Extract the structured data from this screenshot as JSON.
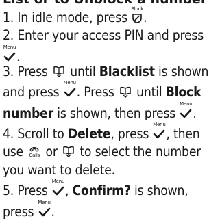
{
  "heading": "List or to Unblock a number",
  "icons": {
    "end_key": "end-call-icon",
    "menu_key": "menu-tick-icon",
    "navigation_key": "phonebook-nav-icon",
    "calls_key": "calls-icon"
  },
  "labels": {
    "block": "Block",
    "menu": "Menu",
    "calls": "Calls"
  },
  "steps": [
    {
      "num": "1.",
      "a": " In idle mode, press ",
      "b": "."
    },
    {
      "num": "2.",
      "a": " Enter your access PIN and press"
    },
    {
      "num": "3.",
      "a": " Press ",
      "b": " until ",
      "c": "Blacklist",
      "d": " is shown",
      "e": "and press ",
      "f": ". Press ",
      "g": " until ",
      "h": "Block",
      "i": "number",
      "j": " is shown, then press ",
      "k": "."
    },
    {
      "num": "4.",
      "a": " Scroll to ",
      "b": "Delete",
      "c": ", press ",
      "d": ", then",
      "e": "use ",
      "f": " or ",
      "g": " to select the number",
      "h": "you want to delete."
    },
    {
      "num": "5.",
      "a": " Press ",
      "b": ", ",
      "c": "Confirm?",
      "d": " is shown,",
      "e": "press ",
      "f": "."
    }
  ]
}
